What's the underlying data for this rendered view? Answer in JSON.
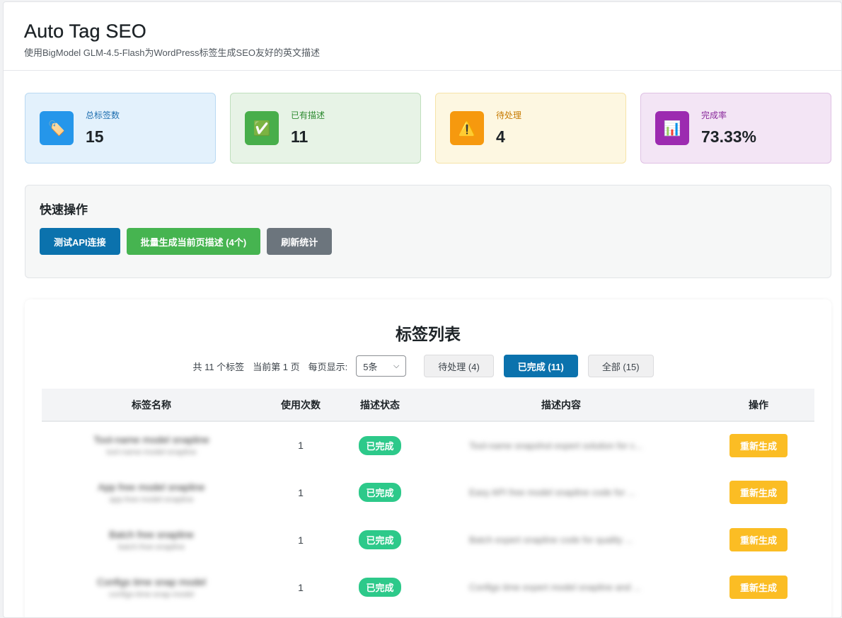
{
  "header": {
    "title": "Auto Tag SEO",
    "subtitle": "使用BigModel GLM-4.5-Flash为WordPress标签生成SEO友好的英文描述"
  },
  "stats": [
    {
      "label": "总标签数",
      "value": "15",
      "icon": "tag-icon",
      "bg": "#e3f1fc",
      "border": "#b9d9f2",
      "icon_bg": "#2596ea",
      "label_color": "#1f6fb0"
    },
    {
      "label": "已有描述",
      "value": "11",
      "icon": "checkmark-icon",
      "bg": "#e7f3e6",
      "border": "#bfdfbc",
      "icon_bg": "#48ae4b",
      "label_color": "#2d8a30"
    },
    {
      "label": "待处理",
      "value": "4",
      "icon": "warning-icon",
      "bg": "#fdf7e1",
      "border": "#f6e3a8",
      "icon_bg": "#f6990e",
      "label_color": "#c77a00"
    },
    {
      "label": "完成率",
      "value": "73.33%",
      "icon": "bar-chart-icon",
      "bg": "#f3e5f5",
      "border": "#dfc1e4",
      "icon_bg": "#9c2bb0",
      "label_color": "#8a2a9c"
    }
  ],
  "quick_actions": {
    "title": "快速操作",
    "test_api": "测试API连接",
    "batch_generate": "批量生成当前页描述 (4个)",
    "refresh": "刷新统计"
  },
  "tag_list": {
    "title": "标签列表",
    "total": "共 11 个标签",
    "current_page": "当前第 1 页",
    "per_page_label": "每页显示:",
    "per_page_value": "5条",
    "filters": {
      "pending": "待处理 (4)",
      "completed": "已完成 (11)",
      "all": "全部 (15)"
    },
    "columns": {
      "name": "标签名称",
      "count": "使用次数",
      "status": "描述状态",
      "content": "描述内容",
      "action": "操作"
    },
    "rows": [
      {
        "name": "Tool-name model snapline",
        "slug": "tool-name-model-snapline",
        "count": "1",
        "status": "已完成",
        "desc": "Tool-name snapshot expert solution for c...",
        "action": "重新生成"
      },
      {
        "name": "App free model snapline",
        "slug": "app-free-model-snapline",
        "count": "1",
        "status": "已完成",
        "desc": "Easy API free model snapline code for ...",
        "action": "重新生成"
      },
      {
        "name": "Batch free snapline",
        "slug": "batch-free-snapline",
        "count": "1",
        "status": "已完成",
        "desc": "Batch expert snapline code for quality ...",
        "action": "重新生成"
      },
      {
        "name": "Configs time snap model",
        "slug": "configs-time-snap-model",
        "count": "1",
        "status": "已完成",
        "desc": "Configs time expert model snapline and ...",
        "action": "重新生成"
      }
    ]
  },
  "colors": {
    "primary": "#0b72ad",
    "success": "#46b450",
    "gray": "#6c757d",
    "badge": "#2dc98a",
    "warning": "#fbbd24"
  }
}
